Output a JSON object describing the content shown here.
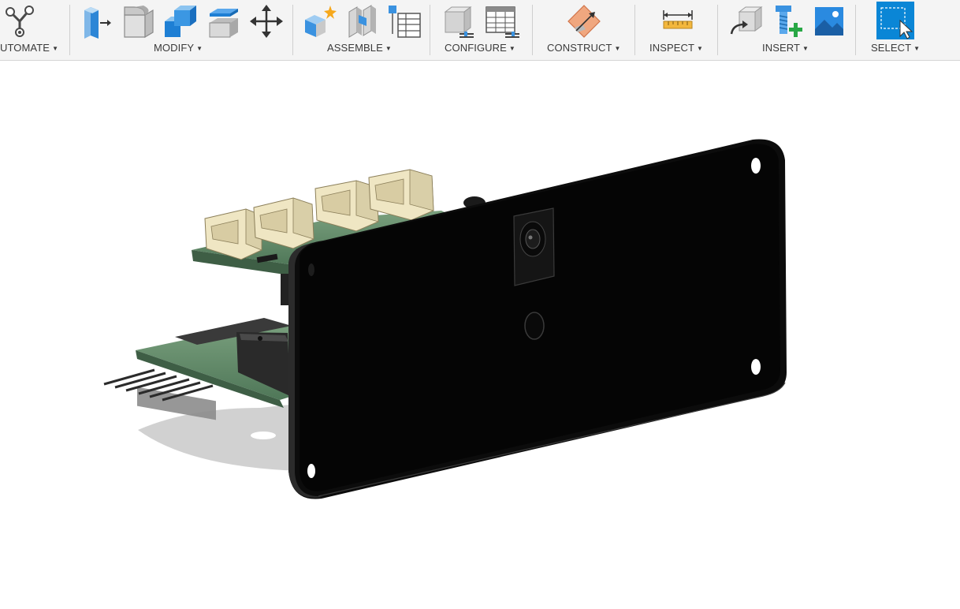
{
  "toolbar": {
    "groups": [
      {
        "key": "automate",
        "label": "UTOMATE"
      },
      {
        "key": "modify",
        "label": "MODIFY"
      },
      {
        "key": "assemble",
        "label": "ASSEMBLE"
      },
      {
        "key": "configure",
        "label": "CONFIGURE"
      },
      {
        "key": "construct",
        "label": "CONSTRUCT"
      },
      {
        "key": "inspect",
        "label": "INSPECT"
      },
      {
        "key": "insert",
        "label": "INSERT"
      },
      {
        "key": "select",
        "label": "SELECT"
      }
    ],
    "icons": {
      "automate": [
        "automate-node-icon"
      ],
      "modify": [
        "press-pull-icon",
        "fillet-icon",
        "combine-icon",
        "offset-face-icon",
        "move-icon"
      ],
      "assemble": [
        "new-component-icon",
        "joint-icon",
        "bom-table-icon"
      ],
      "configure": [
        "configure-body-icon",
        "configure-table-icon"
      ],
      "construct": [
        "construct-plane-icon"
      ],
      "inspect": [
        "measure-icon"
      ],
      "insert": [
        "insert-derive-icon",
        "insert-mcmaster-icon",
        "insert-canvas-icon"
      ],
      "select": [
        "select-window-icon"
      ]
    }
  },
  "colors": {
    "toolbar_bg": "#f4f4f4",
    "accent_blue": "#1e90e0",
    "select_active": "#0a86d6",
    "pcb_green": "#5e8a65",
    "connector_cream": "#efe6c3",
    "panel_black": "#050505"
  },
  "viewport": {
    "model": "3d-pcb-assembly-with-front-panel"
  }
}
